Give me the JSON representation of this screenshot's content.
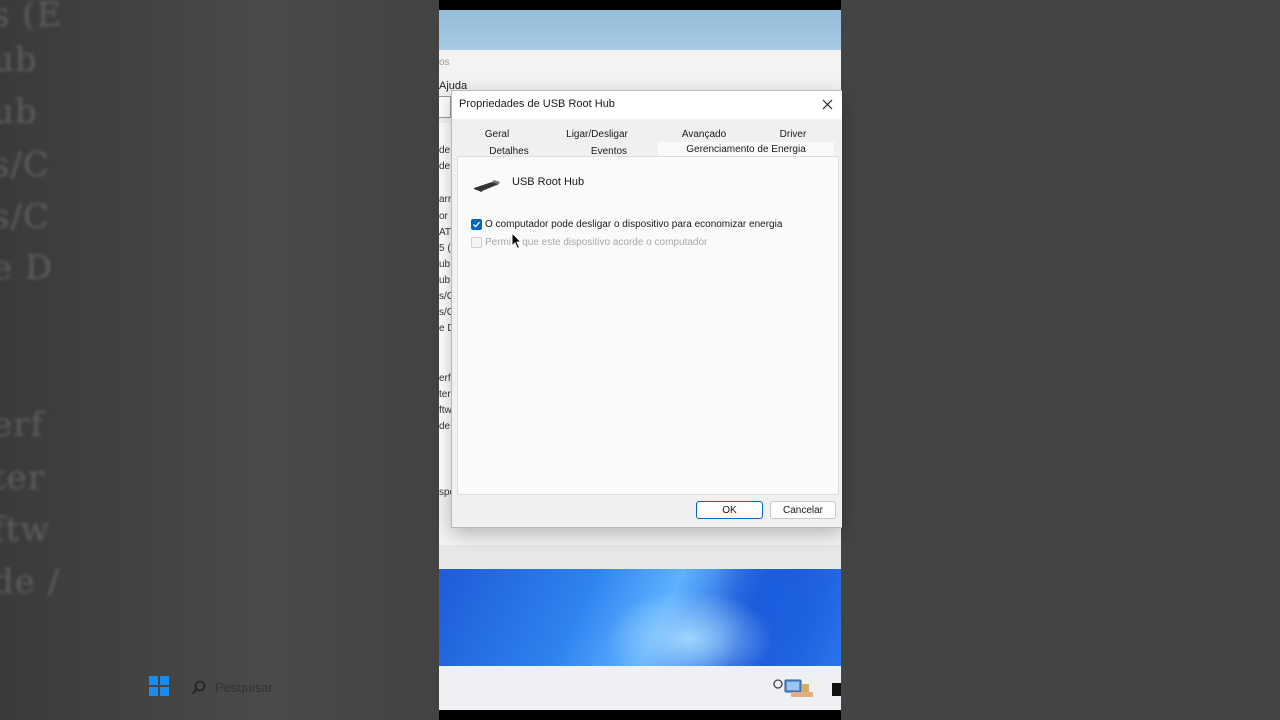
{
  "background": {
    "left_ghost_lines": [
      "s (E",
      "ub",
      "ub",
      "s/C",
      "s/C",
      "e D",
      "erf",
      "ter",
      "ftw",
      "de /"
    ]
  },
  "behind_window": {
    "menu_fragment_top": "os",
    "menu_fragment_help": "Ajuda",
    "left_strip": [
      "de",
      "de",
      "arr",
      "or",
      "AT",
      "5 (l",
      "ub",
      "ub",
      "s/C",
      "s/C",
      "e D",
      "erf",
      "ter",
      "ftw",
      "de /",
      "spo"
    ]
  },
  "dialog": {
    "title": "Propriedades de USB Root Hub",
    "tabs_row1": [
      "Geral",
      "Ligar/Desligar",
      "Avançado",
      "Driver"
    ],
    "tabs_row2": [
      "Detalhes",
      "Eventos",
      "Gerenciamento de Energia"
    ],
    "active_tab": "Gerenciamento de Energia",
    "device_name": "USB Root Hub",
    "option1": {
      "label": "O computador pode desligar o dispositivo para economizar energia",
      "checked": true,
      "enabled": true
    },
    "option2": {
      "label": "Permitir que este dispositivo acorde o computador",
      "checked": false,
      "enabled": false
    },
    "ok_label": "OK",
    "cancel_label": "Cancelar"
  },
  "taskbar": {
    "search_placeholder": "Pesquisar"
  },
  "colors": {
    "accent": "#0067c0",
    "windows_logo": "#1a8cf0"
  }
}
